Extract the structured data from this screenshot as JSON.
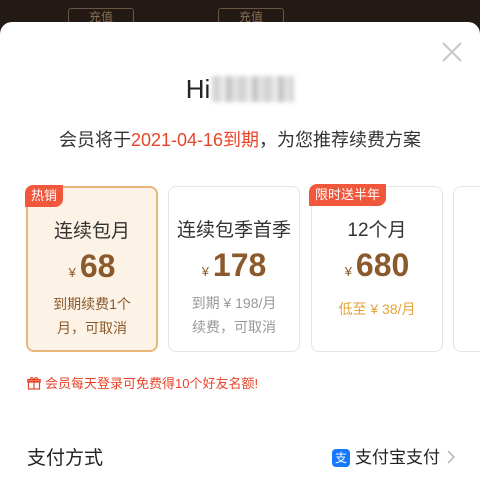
{
  "background_tabs": [
    "充值",
    "充值"
  ],
  "greeting": {
    "text": "Hi"
  },
  "expiry": {
    "prefix": "会员将于",
    "date_text": "2021-04-16到期",
    "suffix": "，为您推荐续费方案"
  },
  "plans": [
    {
      "name": "连续包月",
      "currency": "¥",
      "price": "68",
      "desc_line1": "到期续费1个",
      "desc_line2": "月，可取消",
      "badge": "热销",
      "selected": true
    },
    {
      "name": "连续包季首季",
      "currency": "¥",
      "price": "178",
      "desc_line1": "到期 ¥ 198/月",
      "desc_line2": "续费，可取消",
      "selected": false
    },
    {
      "name": "12个月",
      "currency": "¥",
      "price": "680",
      "desc_line1": "低至 ¥ 38/月",
      "badge": "限时送半年",
      "selected": false
    }
  ],
  "promo": {
    "text": "会员每天登录可免费得10个好友名额!",
    "icon": "gift-icon"
  },
  "payment": {
    "label": "支付方式",
    "method": "支付宝支付",
    "method_icon": "alipay-icon"
  },
  "colors": {
    "accent_red": "#e8442a",
    "brand_gold": "#8a5a2c",
    "selected_bg": "#fdf2e6",
    "selected_border": "#e8b67a",
    "alipay_blue": "#1677ff"
  }
}
